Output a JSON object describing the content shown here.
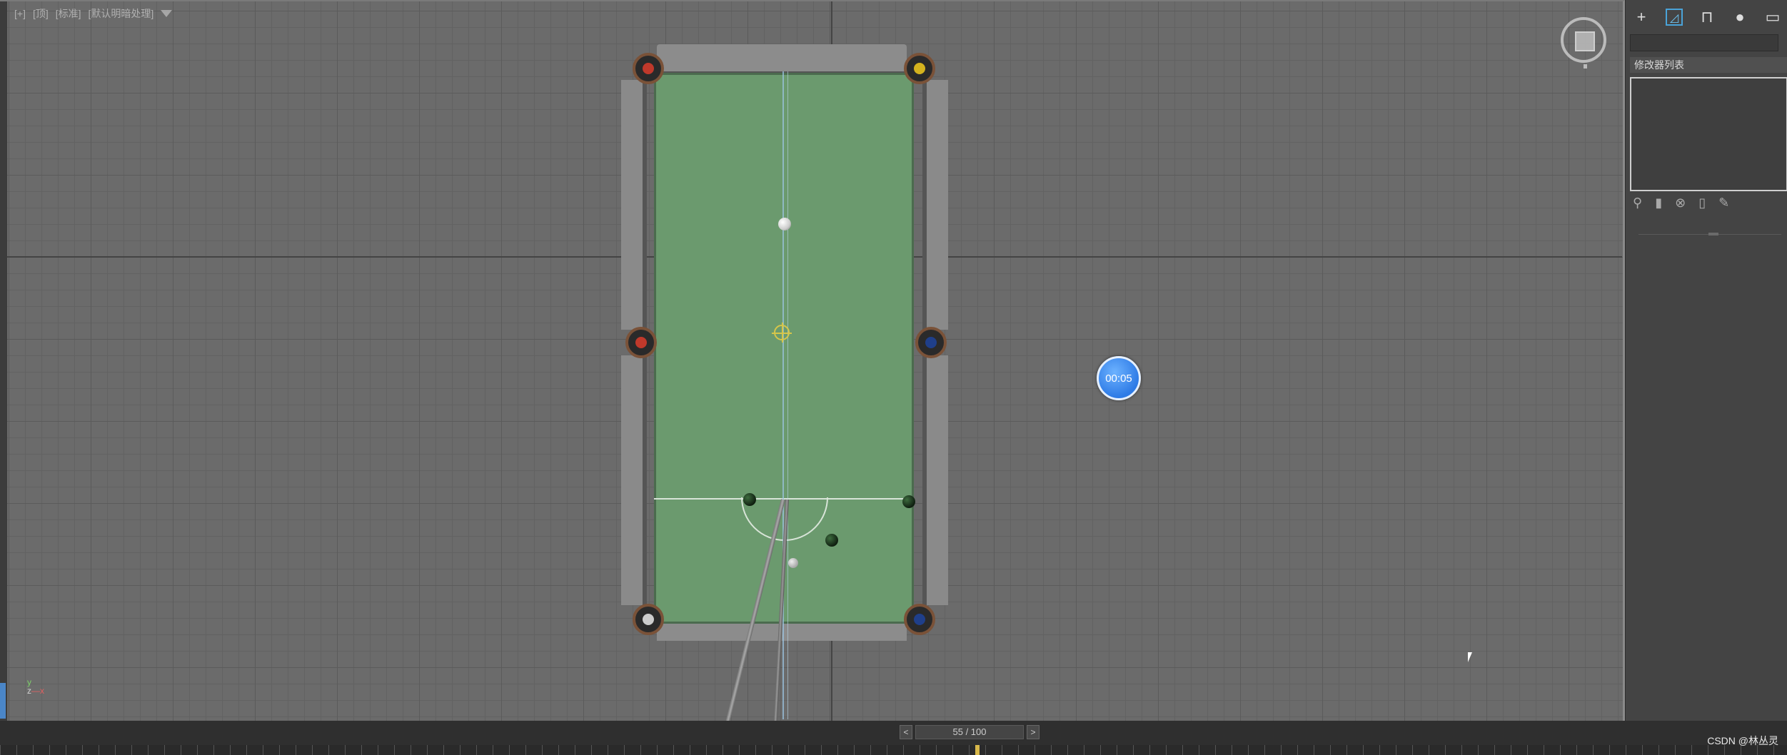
{
  "viewport": {
    "label_parts": [
      "[+]",
      "[顶]",
      "[标准]",
      "[默认明暗处理]"
    ],
    "timer": "00:05"
  },
  "table": {
    "pocket_balls": [
      "#c0392b",
      "#d4b21e",
      "#c0392b",
      "#1f3f8a",
      "#cccccc",
      "#1f3f8a"
    ]
  },
  "timeline": {
    "prev": "<",
    "next": ">",
    "frame_display": "55 / 100",
    "current_frame": 55,
    "total_frames": 100
  },
  "right_panel": {
    "tabs": [
      {
        "icon": "plus-icon",
        "glyph": "+"
      },
      {
        "icon": "modify-icon",
        "glyph": "◿"
      },
      {
        "icon": "hierarchy-icon",
        "glyph": "⊓"
      },
      {
        "icon": "motion-icon",
        "glyph": "●"
      },
      {
        "icon": "display-icon",
        "glyph": "▭"
      },
      {
        "icon": "utilities-icon",
        "glyph": "✎"
      }
    ],
    "modifier_list": "修改器列表",
    "object_color": "#c8165b"
  },
  "credit": "CSDN @林丛灵"
}
